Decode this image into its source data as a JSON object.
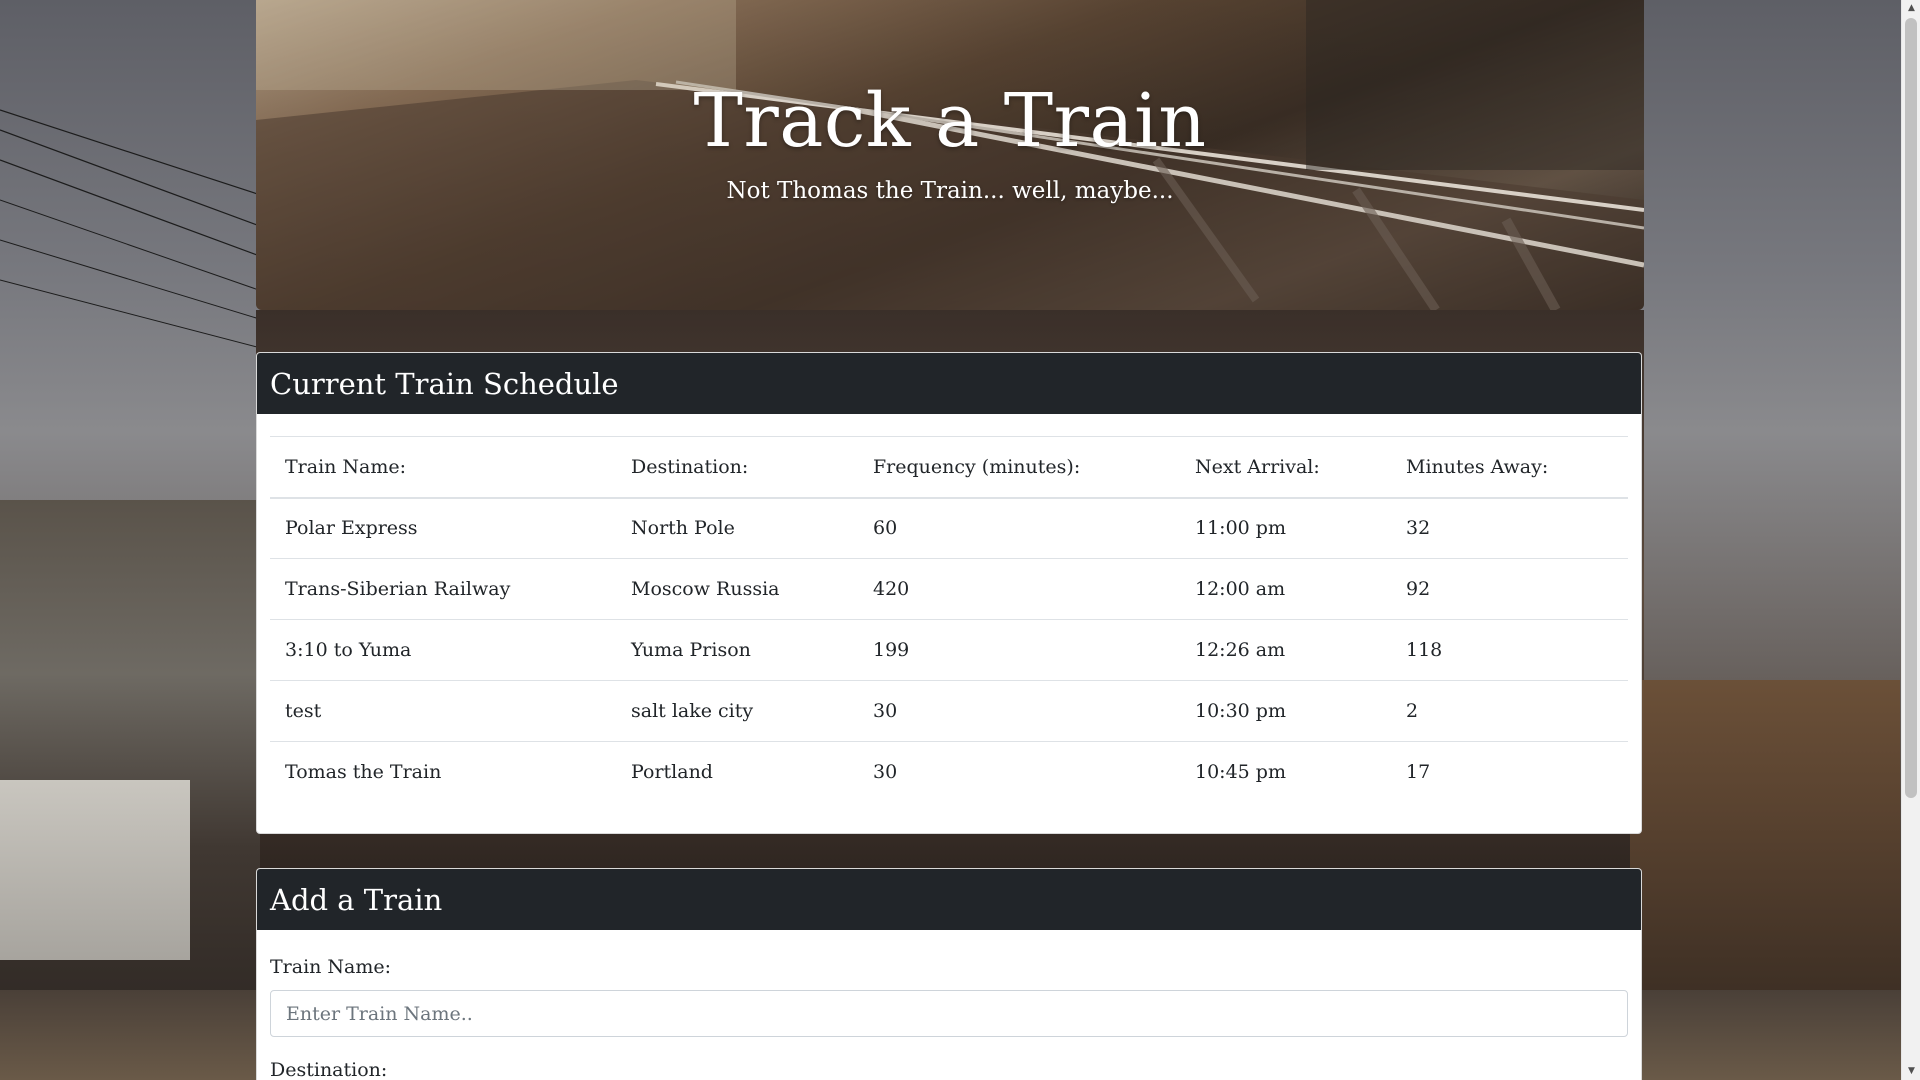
{
  "header": {
    "title": "Track a Train",
    "subtitle": "Not Thomas the Train... well, maybe..."
  },
  "schedule": {
    "heading": "Current Train Schedule",
    "columns": [
      "Train Name:",
      "Destination:",
      "Frequency (minutes):",
      "Next Arrival:",
      "Minutes Away:"
    ],
    "rows": [
      [
        "Polar Express",
        "North Pole",
        "60",
        "11:00 pm",
        "32"
      ],
      [
        "Trans-Siberian Railway",
        "Moscow Russia",
        "420",
        "12:00 am",
        "92"
      ],
      [
        "3:10 to Yuma",
        "Yuma Prison",
        "199",
        "12:26 am",
        "118"
      ],
      [
        "test",
        "salt lake city",
        "30",
        "10:30 pm",
        "2"
      ],
      [
        "Tomas the Train",
        "Portland",
        "30",
        "10:45 pm",
        "17"
      ]
    ]
  },
  "add_form": {
    "heading": "Add a Train",
    "train_name_label": "Train Name:",
    "train_name_placeholder": "Enter Train Name..",
    "destination_label": "Destination:"
  },
  "colors": {
    "card_header": "#212529",
    "card_body": "#ffffff"
  },
  "icons": {
    "scroll_up": "triangle-up-icon",
    "scroll_down": "triangle-down-icon"
  }
}
